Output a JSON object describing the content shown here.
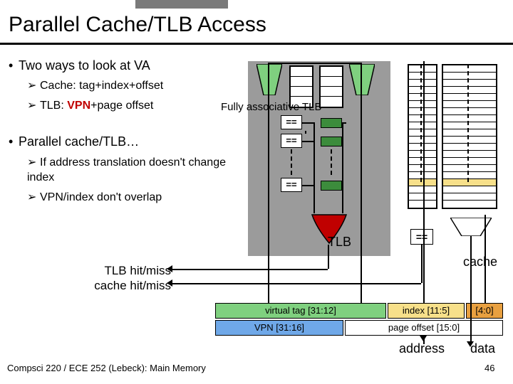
{
  "title": "Parallel Cache/TLB Access",
  "bul": {
    "b1a": "Two ways to look at VA",
    "b2a": "Cache: tag+index+offset",
    "b2b_pre": "TLB: ",
    "b2b_vpn": "VPN",
    "b2b_post": "+page offset",
    "b1b": "Parallel cache/TLB…",
    "b2c": "If address translation doesn't change index",
    "b2d": "VPN/index don't overlap"
  },
  "labels": {
    "fully_assoc": "Fully associative TLB",
    "eq": "==",
    "tlb": "TLB",
    "cache": "cache",
    "tlb_hit": "TLB hit/miss",
    "cache_hit": "cache hit/miss",
    "address": "address",
    "data": "data"
  },
  "fields": {
    "vtag": "virtual tag [31:12]",
    "index": "index [11:5]",
    "off": "[4:0]",
    "vpn": "VPN [31:16]",
    "pageoff": "page offset [15:0]"
  },
  "footer": "Compsci 220 / ECE 252 (Lebeck): Main Memory",
  "page": "46"
}
